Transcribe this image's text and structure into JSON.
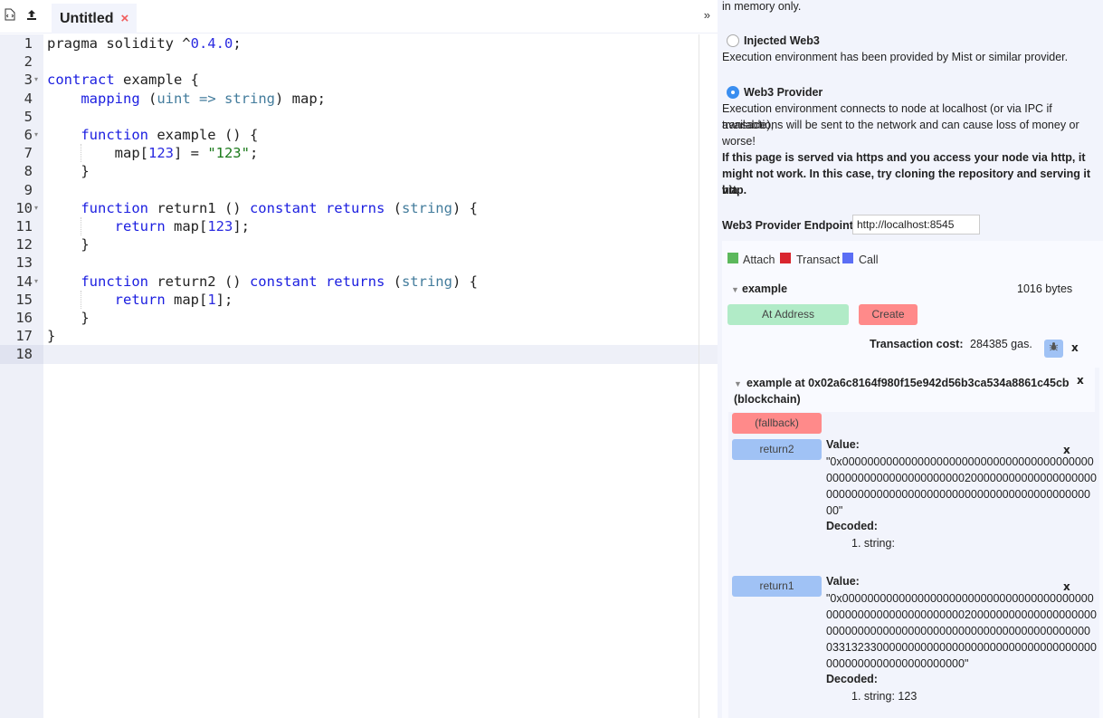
{
  "editor": {
    "tabs": [
      {
        "label": "Untitled",
        "close_icon": "×"
      }
    ],
    "toolbar_icons": [
      "new-file-icon",
      "upload-icon"
    ],
    "collapse_right_label": "»",
    "active_line": 18,
    "lines": [
      "pragma solidity ^0.4.0;",
      "",
      "contract example {",
      "    mapping (uint => string) map;",
      "",
      "    function example () {",
      "        map[123] = \"123\";",
      "    }",
      "",
      "    function return1 () constant returns (string) {",
      "        return map[123];",
      "    }",
      "",
      "    function return2 () constant returns (string) {",
      "        return map[1];",
      "    }",
      "}",
      ""
    ],
    "foldable_lines": [
      3,
      6,
      10,
      14
    ]
  },
  "environment": {
    "vm_tail": "in memory only.",
    "options": [
      {
        "label": "Injected Web3",
        "checked": false,
        "description": "Execution environment has been provided by Mist or similar provider."
      },
      {
        "label": "Web3 Provider",
        "checked": true,
        "description_lines": [
          "Execution environment connects to node at localhost (or via IPC if available),",
          "transactions will be sent to the network and can cause loss of money or",
          "worse!"
        ],
        "warning_lines": [
          "If this page is served via https and you access your node via http, it",
          "might not work. In this case, try cloning the repository and serving it via",
          "http."
        ]
      }
    ],
    "endpoint_label": "Web3 Provider Endpoint:",
    "endpoint_value": "http://localhost:8545"
  },
  "legend": [
    {
      "label": "Attach",
      "color": "#5cb85c"
    },
    {
      "label": "Transact",
      "color": "#d9262f"
    },
    {
      "label": "Call",
      "color": "#5b6ef5"
    }
  ],
  "contract": {
    "name": "example",
    "size": "1016 bytes",
    "at_address_label": "At Address",
    "create_label": "Create",
    "tx_cost_label": "Transaction cost:",
    "tx_cost_value": "284385 gas.",
    "close_label": "x"
  },
  "instance": {
    "title_line1": "example at 0x02a6c8164f980f15e942d56b3ca534a8861c45cb",
    "title_line2": "(blockchain)",
    "close_label": "x",
    "fallback_label": "(fallback)",
    "calls": [
      {
        "button": "return2",
        "value_label": "Value:",
        "value_lines": [
          "\"0x0000000000000000000000000000000000000000",
          "0000000000000000000000200000000000000000000",
          "000000000000000000000000000000000000000000",
          "00\""
        ],
        "decoded_label": "Decoded:",
        "decoded": [
          "1. string:"
        ],
        "close_label": "x"
      },
      {
        "button": "return1",
        "value_label": "Value:",
        "value_lines": [
          "\"0x0000000000000000000000000000000000000000",
          "0000000000000000000000200000000000000000000",
          "000000000000000000000000000000000000000000",
          "0331323300000000000000000000000000000000000",
          "0000000000000000000000\""
        ],
        "decoded_label": "Decoded:",
        "decoded": [
          "1. string: 123"
        ],
        "close_label": "x"
      }
    ]
  }
}
